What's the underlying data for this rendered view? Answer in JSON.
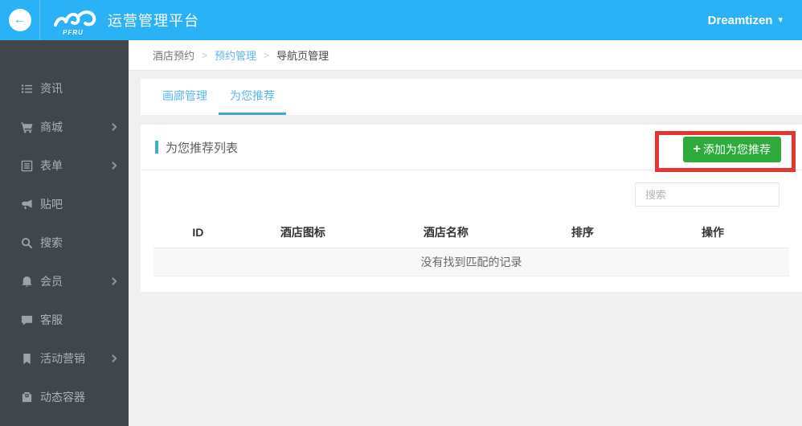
{
  "header": {
    "app_title": "运营管理平台",
    "logo_sub": "PFRU",
    "user_menu_label": "Dreamtizen"
  },
  "icons": {
    "back_arrow": "←",
    "caret_down": "▾",
    "plus": "+",
    "breadcrumb_separator": ">"
  },
  "sidebar": {
    "items": [
      {
        "label": "资讯",
        "icon": "list-icon",
        "has_submenu": false
      },
      {
        "label": "商城",
        "icon": "cart-icon",
        "has_submenu": true
      },
      {
        "label": "表单",
        "icon": "form-icon",
        "has_submenu": true
      },
      {
        "label": "贴吧",
        "icon": "bullhorn-icon",
        "has_submenu": false
      },
      {
        "label": "搜索",
        "icon": "search-icon",
        "has_submenu": false
      },
      {
        "label": "会员",
        "icon": "bell-icon",
        "has_submenu": true
      },
      {
        "label": "客服",
        "icon": "comment-icon",
        "has_submenu": false
      },
      {
        "label": "活动营销",
        "icon": "bookmark-icon",
        "has_submenu": true
      },
      {
        "label": "动态容器",
        "icon": "container-icon",
        "has_submenu": false
      }
    ]
  },
  "breadcrumb": {
    "items": [
      {
        "label": "酒店预约"
      },
      {
        "label": "预约管理"
      },
      {
        "label": "导航页管理"
      }
    ]
  },
  "tabs": [
    {
      "label": "画廊管理",
      "active": false
    },
    {
      "label": "为您推荐",
      "active": true
    }
  ],
  "panel": {
    "title": "为您推荐列表",
    "add_button_label": "添加为您推荐",
    "search_placeholder": "搜索"
  },
  "table": {
    "columns": [
      "ID",
      "酒店图标",
      "酒店名称",
      "排序",
      "操作"
    ],
    "rows": [],
    "empty_text": "没有找到匹配的记录"
  },
  "colors": {
    "header_bg": "#2bb2f6",
    "sidebar_bg": "#3f464c",
    "link_blue": "#56b8e9",
    "tab_underline": "#44a5da",
    "accent_blue": "#3baddb",
    "button_green": "#2dab3c",
    "annotation_red": "#e6352f"
  }
}
